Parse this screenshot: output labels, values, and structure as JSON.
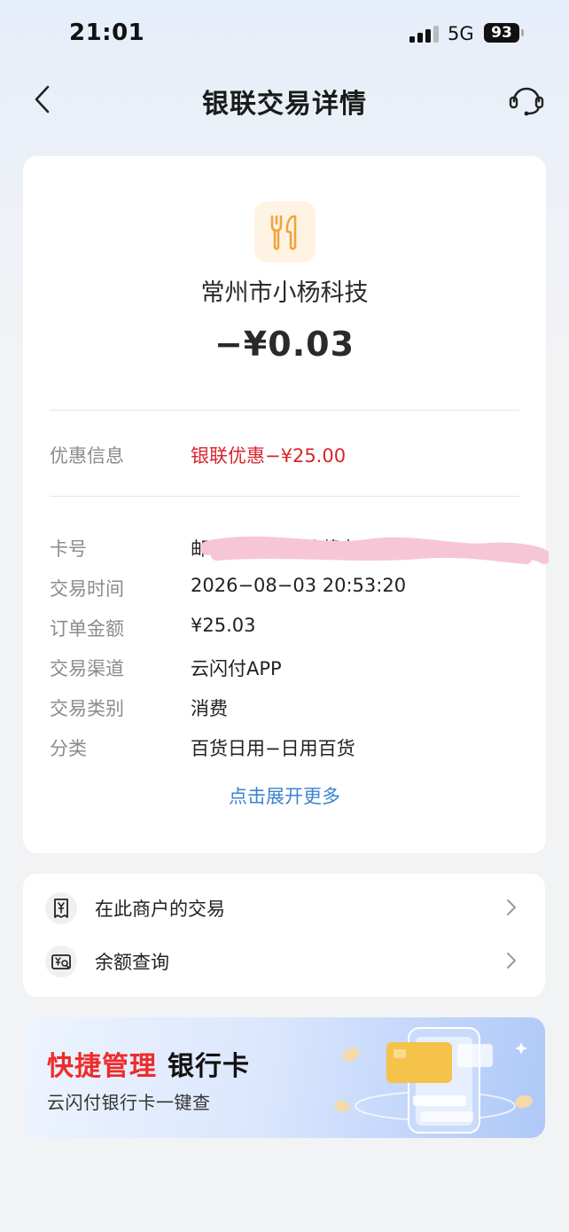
{
  "status_bar": {
    "time": "21:01",
    "network": "5G",
    "battery": "93"
  },
  "nav": {
    "title": "银联交易详情"
  },
  "transaction": {
    "merchant": "常州市小杨科技",
    "amount": "−¥0.03",
    "discount_label": "优惠信息",
    "discount_value": "银联优惠−¥25.00",
    "details": [
      {
        "label": "卡号",
        "value": "邮储银行银联储蓄卡"
      },
      {
        "label": "交易时间",
        "value": "2026−08−03 20:53:20"
      },
      {
        "label": "订单金额",
        "value": "¥25.03"
      },
      {
        "label": "交易渠道",
        "value": "云闪付APP"
      },
      {
        "label": "交易类别",
        "value": "消费"
      },
      {
        "label": "分类",
        "value": "百货日用−日用百货"
      }
    ],
    "expand_more": "点击展开更多"
  },
  "links": [
    {
      "label": "在此商户的交易",
      "icon": "receipt-yen-icon"
    },
    {
      "label": "余额查询",
      "icon": "balance-search-icon"
    }
  ],
  "banner": {
    "title_red": "快捷管理",
    "title_black": "银行卡",
    "subtitle": "云闪付银行卡一键查"
  },
  "colors": {
    "accent_red": "#d8252d",
    "link_blue": "#3c83d1",
    "icon_orange": "#f0a53c"
  }
}
